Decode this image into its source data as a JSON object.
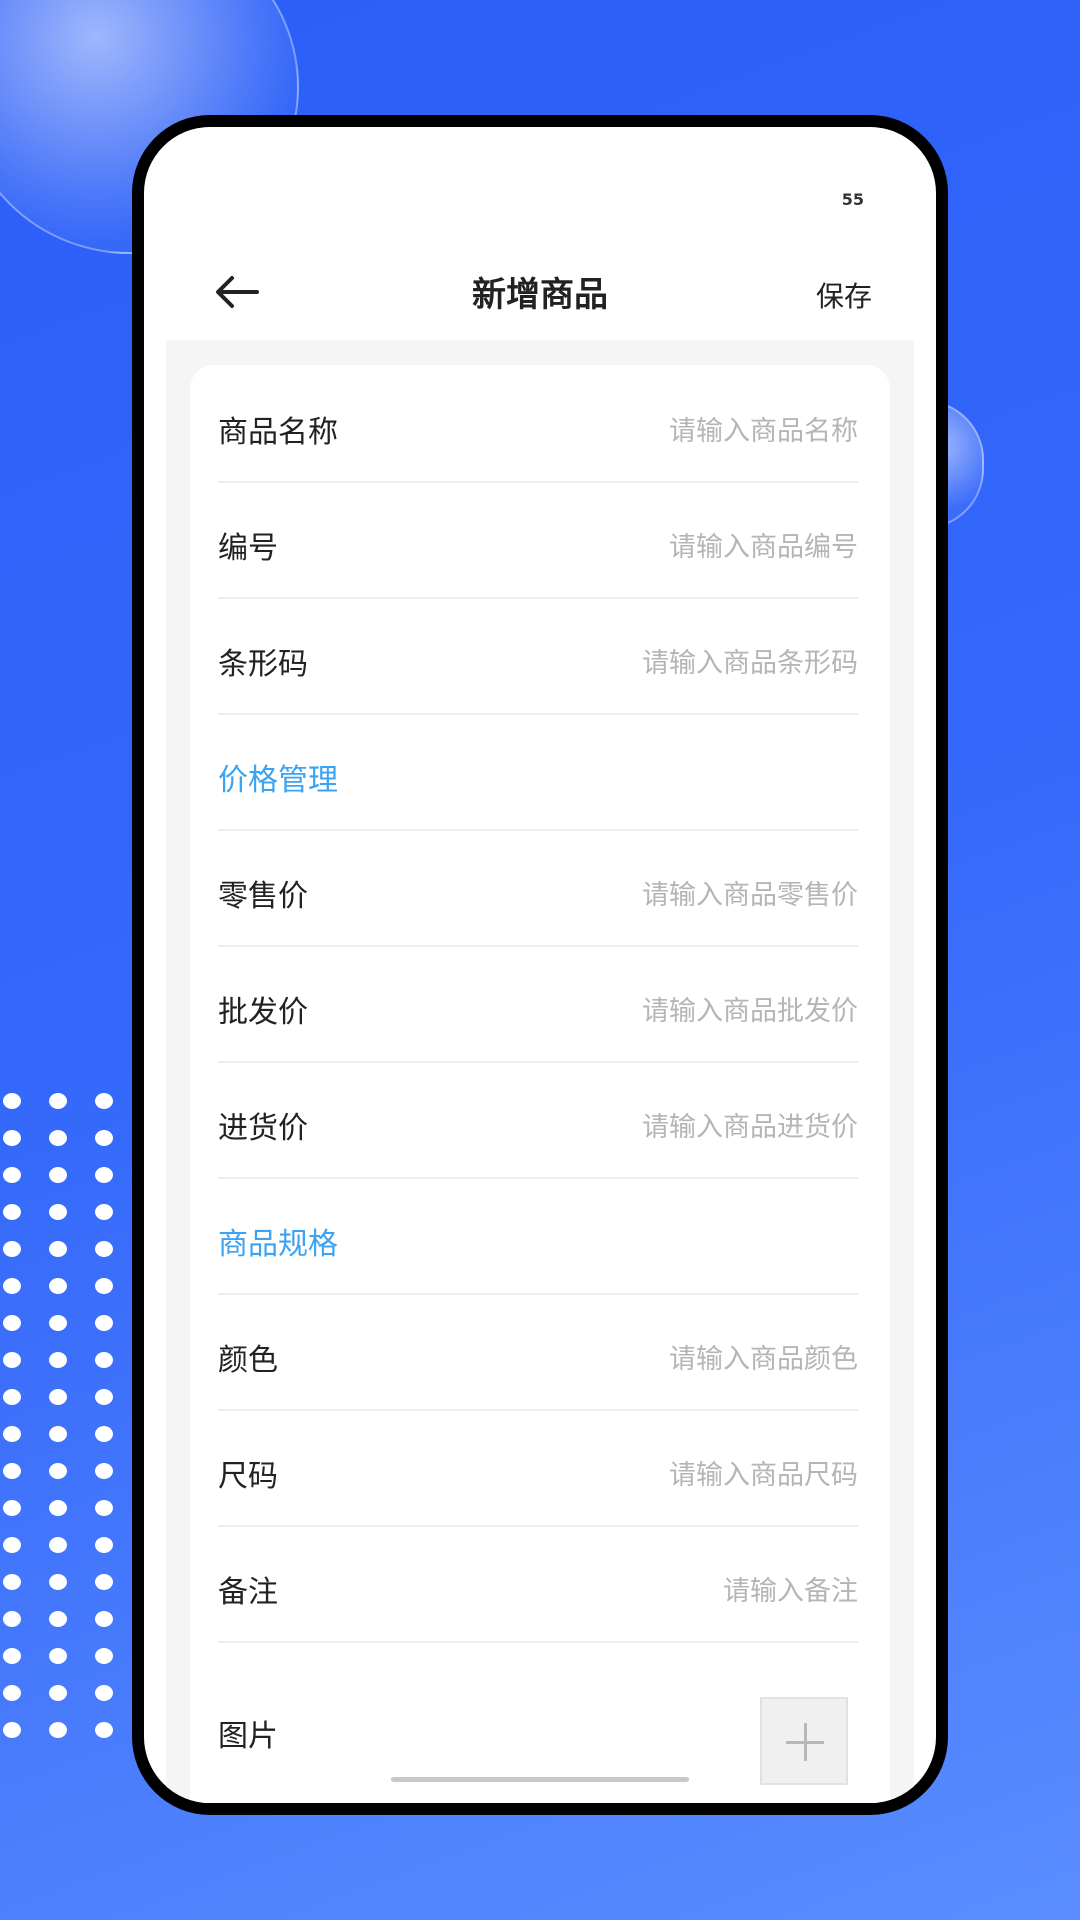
{
  "status_bar": {
    "value": "55"
  },
  "header": {
    "title": "新增商品",
    "save_label": "保存",
    "back_icon": "arrow-left-icon"
  },
  "form": {
    "rows": [
      {
        "label": "商品名称",
        "placeholder": "请输入商品名称"
      },
      {
        "label": "编号",
        "placeholder": "请输入商品编号"
      },
      {
        "label": "条形码",
        "placeholder": "请输入商品条形码"
      },
      {
        "section": "价格管理"
      },
      {
        "label": "零售价",
        "placeholder": "请输入商品零售价"
      },
      {
        "label": "批发价",
        "placeholder": "请输入商品批发价"
      },
      {
        "label": "进货价",
        "placeholder": "请输入商品进货价"
      },
      {
        "section": "商品规格"
      },
      {
        "label": "颜色",
        "placeholder": "请输入商品颜色"
      },
      {
        "label": "尺码",
        "placeholder": "请输入商品尺码"
      },
      {
        "label": "备注",
        "placeholder": "请输入备注"
      }
    ],
    "image_label": "图片",
    "upload_icon": "plus-icon"
  },
  "colors": {
    "background": "#2a5ef8",
    "section": "#3ba3f2",
    "placeholder": "#b5b5b5"
  }
}
